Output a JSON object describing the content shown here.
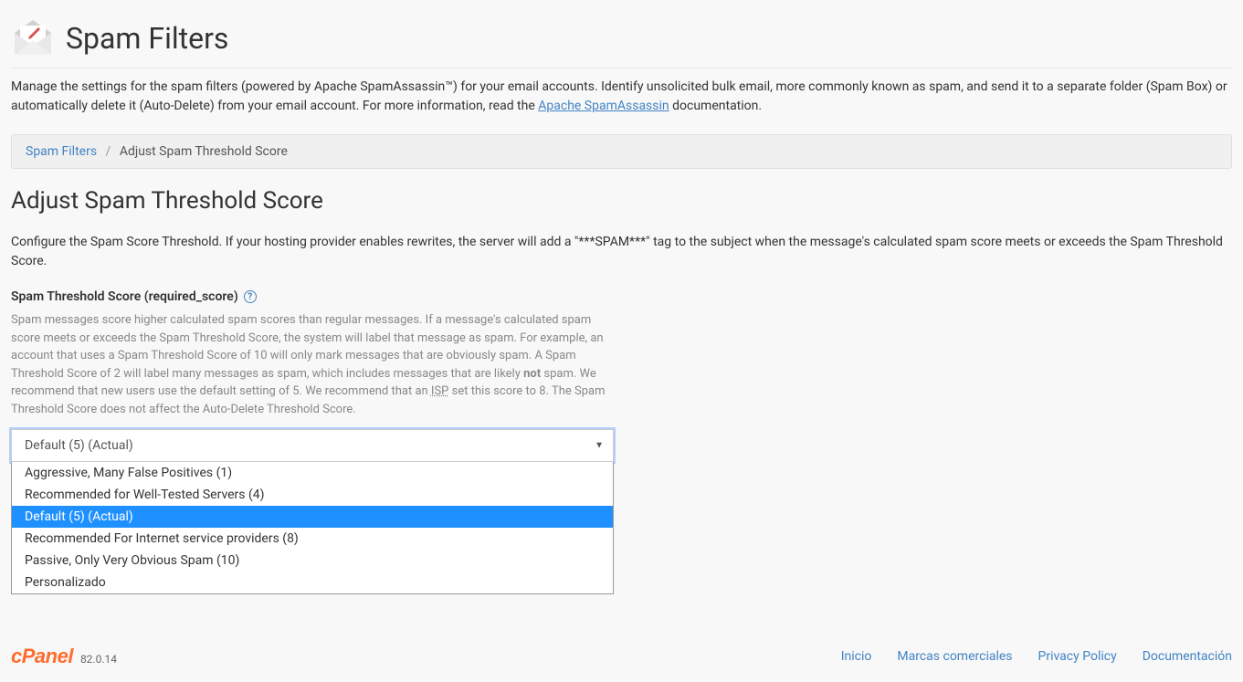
{
  "header": {
    "title": "Spam Filters"
  },
  "intro": {
    "text_before_link": "Manage the settings for the spam filters (powered by Apache SpamAssassin™) for your email accounts. Identify unsolicited bulk email, more commonly known as spam, and send it to a separate folder (Spam Box) or automatically delete it (Auto-Delete) from your email account. For more information, read the ",
    "link_text": "Apache SpamAssassin",
    "text_after_link": " documentation."
  },
  "breadcrumb": {
    "root": "Spam Filters",
    "current": "Adjust Spam Threshold Score"
  },
  "section": {
    "heading": "Adjust Spam Threshold Score",
    "description": "Configure the Spam Score Threshold. If your hosting provider enables rewrites, the server will add a \"***SPAM***\" tag to the subject when the message's calculated spam score meets or exceeds the Spam Threshold Score."
  },
  "field": {
    "label": "Spam Threshold Score (required_score)",
    "help_before_strong": "Spam messages score higher calculated spam scores than regular messages. If a message's calculated spam score meets or exceeds the Spam Threshold Score, the system will label that message as spam. For example, an account that uses a Spam Threshold Score of 10 will only mark messages that are obviously spam. A Spam Threshold Score of 2 will label many messages as spam, which includes messages that are likely ",
    "help_strong": "not",
    "help_after_strong": " spam. We recommend that new users use the default setting of 5. We recommend that an ",
    "help_isp": "ISP",
    "help_tail": " set this score to 8. The Spam Threshold Score does not affect the Auto-Delete Threshold Score."
  },
  "select": {
    "current": "Default (5) (Actual)",
    "options": [
      "Aggressive, Many False Positives (1)",
      "Recommended for Well-Tested Servers (4)",
      "Default (5) (Actual)",
      "Recommended For Internet service providers (8)",
      "Passive, Only Very Obvious Spam (10)",
      "Personalizado"
    ],
    "selected_index": 2
  },
  "footer": {
    "brand": "cPanel",
    "version": "82.0.14",
    "links": [
      "Inicio",
      "Marcas comerciales",
      "Privacy Policy",
      "Documentación"
    ]
  }
}
